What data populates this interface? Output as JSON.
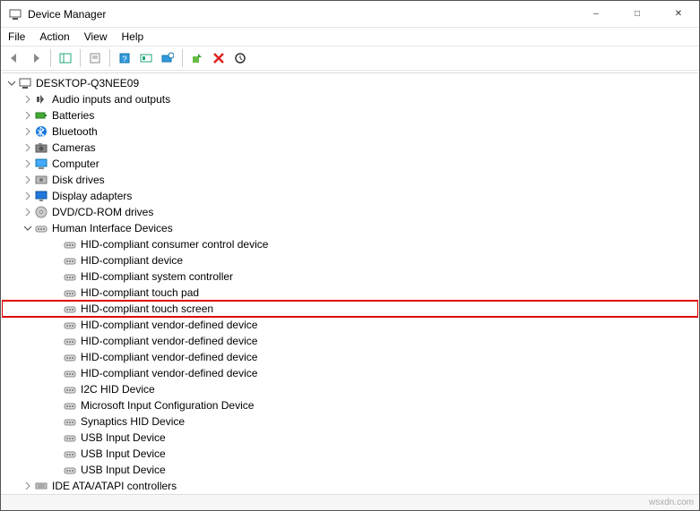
{
  "window": {
    "title": "Device Manager"
  },
  "menu": {
    "file": "File",
    "action": "Action",
    "view": "View",
    "help": "Help"
  },
  "tree": {
    "root": "DESKTOP-Q3NEE09",
    "nodes": [
      {
        "label": "Audio inputs and outputs",
        "icon": "audio",
        "expanded": false,
        "expandable": true
      },
      {
        "label": "Batteries",
        "icon": "battery",
        "expanded": false,
        "expandable": true
      },
      {
        "label": "Bluetooth",
        "icon": "bluetooth",
        "expanded": false,
        "expandable": true
      },
      {
        "label": "Cameras",
        "icon": "camera",
        "expanded": false,
        "expandable": true
      },
      {
        "label": "Computer",
        "icon": "computer",
        "expanded": false,
        "expandable": true
      },
      {
        "label": "Disk drives",
        "icon": "disk",
        "expanded": false,
        "expandable": true
      },
      {
        "label": "Display adapters",
        "icon": "display",
        "expanded": false,
        "expandable": true
      },
      {
        "label": "DVD/CD-ROM drives",
        "icon": "dvd",
        "expanded": false,
        "expandable": true
      },
      {
        "label": "Human Interface Devices",
        "icon": "hid",
        "expanded": true,
        "expandable": true,
        "children": [
          {
            "label": "HID-compliant consumer control device"
          },
          {
            "label": "HID-compliant device"
          },
          {
            "label": "HID-compliant system controller"
          },
          {
            "label": "HID-compliant touch pad"
          },
          {
            "label": "HID-compliant touch screen",
            "highlight": true
          },
          {
            "label": "HID-compliant vendor-defined device"
          },
          {
            "label": "HID-compliant vendor-defined device"
          },
          {
            "label": "HID-compliant vendor-defined device"
          },
          {
            "label": "HID-compliant vendor-defined device"
          },
          {
            "label": "I2C HID Device"
          },
          {
            "label": "Microsoft Input Configuration Device"
          },
          {
            "label": "Synaptics HID Device"
          },
          {
            "label": "USB Input Device"
          },
          {
            "label": "USB Input Device"
          },
          {
            "label": "USB Input Device"
          }
        ]
      },
      {
        "label": "IDE ATA/ATAPI controllers",
        "icon": "ide",
        "expanded": false,
        "expandable": true
      }
    ]
  },
  "watermark": "wsxdn.com"
}
